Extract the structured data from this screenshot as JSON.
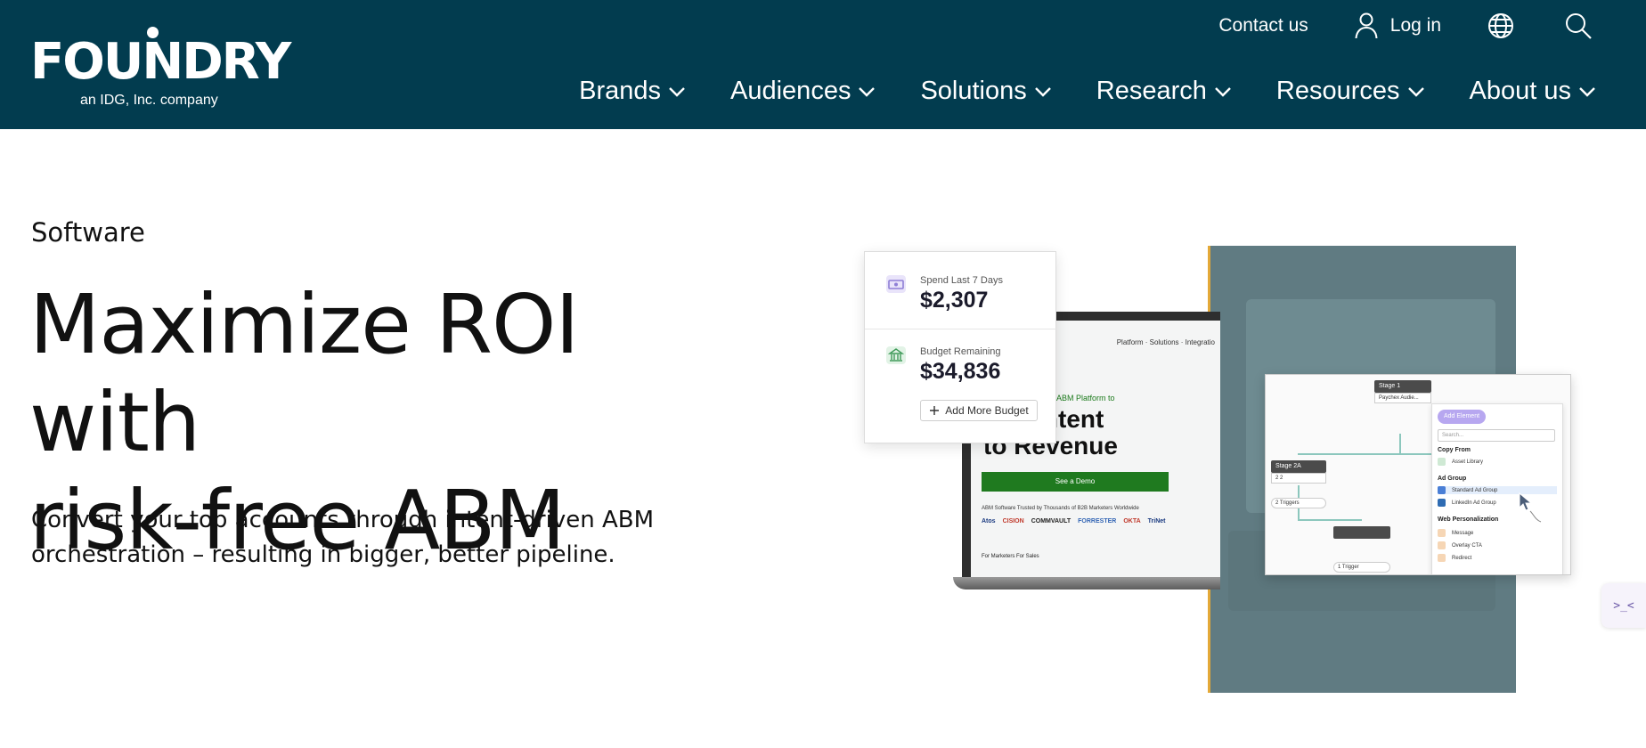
{
  "brand": {
    "name": "FOUNDRY",
    "tagline": "an IDG, Inc. company",
    "header_color": "#023c4f"
  },
  "utility_nav": {
    "contact": "Contact us",
    "login": "Log in",
    "icons": [
      "user-icon",
      "globe-icon",
      "search-icon"
    ]
  },
  "main_nav": {
    "items": [
      {
        "label": "Brands"
      },
      {
        "label": "Audiences"
      },
      {
        "label": "Solutions"
      },
      {
        "label": "Research"
      },
      {
        "label": "Resources"
      },
      {
        "label": "About us"
      }
    ]
  },
  "hero": {
    "eyebrow": "Software",
    "headline_line1": "Maximize ROI with",
    "headline_line2": "risk-free ABM",
    "subhead_line1": "Convert your top accounts through intent-driven ABM",
    "subhead_line2": "orchestration – resulting in bigger, better pipeline."
  },
  "hero_image": {
    "budget_card": {
      "spend_label": "Spend Last 7 Days",
      "spend_value": "$2,307",
      "remaining_label": "Budget Remaining",
      "remaining_value": "$34,836",
      "button": "Add More Budget"
    },
    "laptop_screen": {
      "nav": "Platform ·   Solutions ·   Integratio",
      "kicker": "Orchestration ABM Platform to",
      "title_line1": "vert Intent",
      "title_line2": "to Revenue",
      "cta": "See a Demo",
      "trust": "ABM Software Trusted by Thousands of B2B Marketers Worldwide",
      "logos": [
        "Atos",
        "CISION",
        "COMMVAULT",
        "FORRESTER",
        "OKTA",
        "TriNet"
      ],
      "tabs": "For Marketers     For Sales"
    },
    "flow_card": {
      "stage1": "Stage 1",
      "stage1_body": "Paychex Audie...",
      "stage2a": "Stage 2A",
      "stage2a_counts": "2    2",
      "triggers": "2 Triggers",
      "trigger": "1 Trigger",
      "menu_button": "Add Element",
      "menu_search": "Search...",
      "section_copy": "Copy From",
      "opt_asset": "Asset Library",
      "section_ad": "Ad Group",
      "opt_standard": "Standard Ad Group",
      "opt_linkedin": "LinkedIn Ad Group",
      "section_web": "Web Personalization",
      "opt_message": "Message",
      "opt_overlay": "Overlay CTA",
      "opt_redirect": "Redirect"
    }
  },
  "side_widget": {
    "glyph": ">_<"
  }
}
